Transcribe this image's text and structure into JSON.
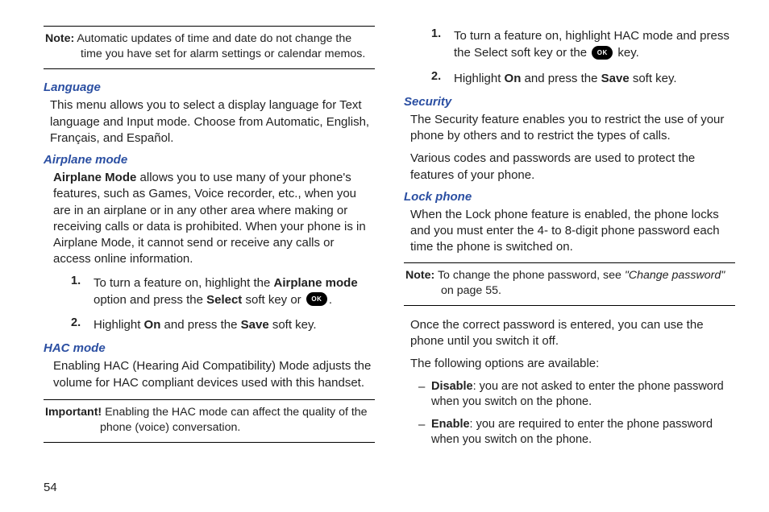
{
  "left": {
    "note": {
      "lead": "Note:",
      "text": " Automatic updates of time and date do not change the time you have set for alarm settings or calendar memos."
    },
    "language": {
      "heading": "Language",
      "para": "This menu allows you to select a display language for Text language and Input mode. Choose from Automatic, English, Français, and Español."
    },
    "airplane": {
      "heading": "Airplane mode",
      "para_pre": "Airplane Mode",
      "para_rest": " allows you to use many of your phone's features, such as Games, Voice recorder, etc., when you are in an airplane or in any other area where making or receiving calls or data is prohibited. When your phone is in Airplane Mode, it cannot send or receive any calls or access online information.",
      "steps": [
        {
          "num": "1.",
          "t1": "To turn a feature on, highlight the ",
          "b1": "Airplane mode",
          "t2": " option and press the ",
          "b2": "Select",
          "t3": " soft key or ",
          "t4": "."
        },
        {
          "num": "2.",
          "t1": "Highlight ",
          "b1": "On",
          "t2": " and press the ",
          "b2": "Save",
          "t3": " soft key."
        }
      ]
    },
    "hac": {
      "heading": "HAC mode",
      "para": "Enabling HAC (Hearing Aid Compatibility) Mode adjusts the volume for HAC compliant devices used with this handset."
    },
    "important": {
      "lead": "Important!",
      "text": " Enabling the HAC mode can affect the quality of the phone (voice) conversation."
    }
  },
  "right": {
    "steps": [
      {
        "num": "1.",
        "t1": "To turn a feature on, highlight HAC mode and press the Select soft key or the ",
        "t2": " key."
      },
      {
        "num": "2.",
        "t1": "Highlight ",
        "b1": "On",
        "t2": " and press the ",
        "b2": "Save",
        "t3": " soft key."
      }
    ],
    "security": {
      "heading": "Security",
      "p1": "The Security feature enables you to restrict the use of your phone by others and to restrict the types of calls.",
      "p2": "Various codes and passwords are used to protect the features of your phone."
    },
    "lockphone": {
      "heading": "Lock phone",
      "p1": "When the Lock phone feature is enabled, the phone locks and you must enter the 4- to 8-digit phone password each time the phone is switched on."
    },
    "note": {
      "lead": "Note:",
      "t1": " To change the phone password, see ",
      "quote": "\"Change password\"",
      "t2": " on page 55."
    },
    "after": {
      "p1": "Once the correct password is entered, you can use the phone until you switch it off.",
      "p2": "The following options are available:"
    },
    "options": [
      {
        "label": "Disable",
        "text": ": you are not asked to enter the phone password when you switch on the phone."
      },
      {
        "label": "Enable",
        "text": ": you are required to enter the phone password when you switch on the phone."
      }
    ]
  },
  "page_number": "54",
  "ok_label": "OK"
}
